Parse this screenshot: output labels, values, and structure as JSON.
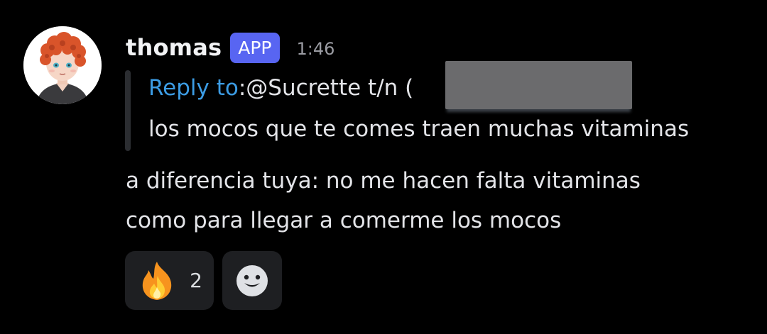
{
  "message": {
    "username": "thomas",
    "badge": "APP",
    "timestamp": "1:46",
    "reply": {
      "prefix": "Reply to",
      "separator": ":",
      "mention": " @Sucrette t/n (",
      "quoted_text": "los mocos que te comes traen muchas vitaminas"
    },
    "body_lines": [
      "a diferencia tuya: no me hacen falta vitaminas",
      "como para llegar a comerme los mocos"
    ],
    "reactions": [
      {
        "emoji": "fire-emoji",
        "count": "2"
      }
    ],
    "add_reaction_icon": "smiley-add-reaction-icon"
  },
  "colors": {
    "background": "#000000",
    "app_badge": "#5865f2",
    "reply_link": "#3c9ce4",
    "timestamp": "#9b9ca3",
    "reaction_bg": "#1e1f22"
  }
}
